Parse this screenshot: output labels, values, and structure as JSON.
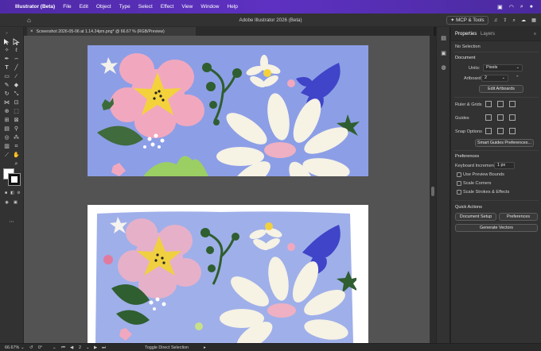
{
  "menubar": {
    "app_name": "Illustrator (Beta)",
    "items": [
      "File",
      "Edit",
      "Object",
      "Type",
      "Select",
      "Effect",
      "View",
      "Window",
      "Help"
    ]
  },
  "titlebar": {
    "title": "Adobe Illustrator 2026 (Beta)",
    "mcp_label": "MCP & Tools"
  },
  "document_tab": {
    "title": "Screenshot 2026-05-06 at 1.14.24pm.png* @ 66.67 % (RGB/Preview)"
  },
  "properties": {
    "tab_properties": "Properties",
    "tab_layers": "Layers",
    "selection": "No Selection",
    "document_section": "Document",
    "units_label": "Units:",
    "units_value": "Pixels",
    "artboard_label": "Artboard:",
    "artboard_value": "2",
    "edit_artboards": "Edit Artboards",
    "rulers_grids": "Ruler & Grids",
    "guides": "Guides",
    "snap_options": "Snap Options",
    "smart_guides_prefs": "Smart Guides Preferences...",
    "preferences_section": "Preferences",
    "keyboard_increment_label": "Keyboard Increment:",
    "keyboard_increment_value": "1 px",
    "use_preview_bounds": "Use Preview Bounds",
    "scale_corners": "Scale Corners",
    "scale_strokes": "Scale Strokes & Effects",
    "quick_actions": "Quick Actions",
    "document_setup": "Document Setup",
    "preferences_btn": "Preferences",
    "generate_vectors": "Generate Vectors"
  },
  "statusbar": {
    "zoom": "66.67%",
    "rotation": "0°",
    "artboard_nav": "2",
    "tool_hint": "Toggle Direct Selection"
  },
  "colors": {
    "menubar": "#5a2fbf",
    "artboard_bg": "#8c9ee6",
    "canvas": "#535353",
    "panel": "#323232"
  }
}
